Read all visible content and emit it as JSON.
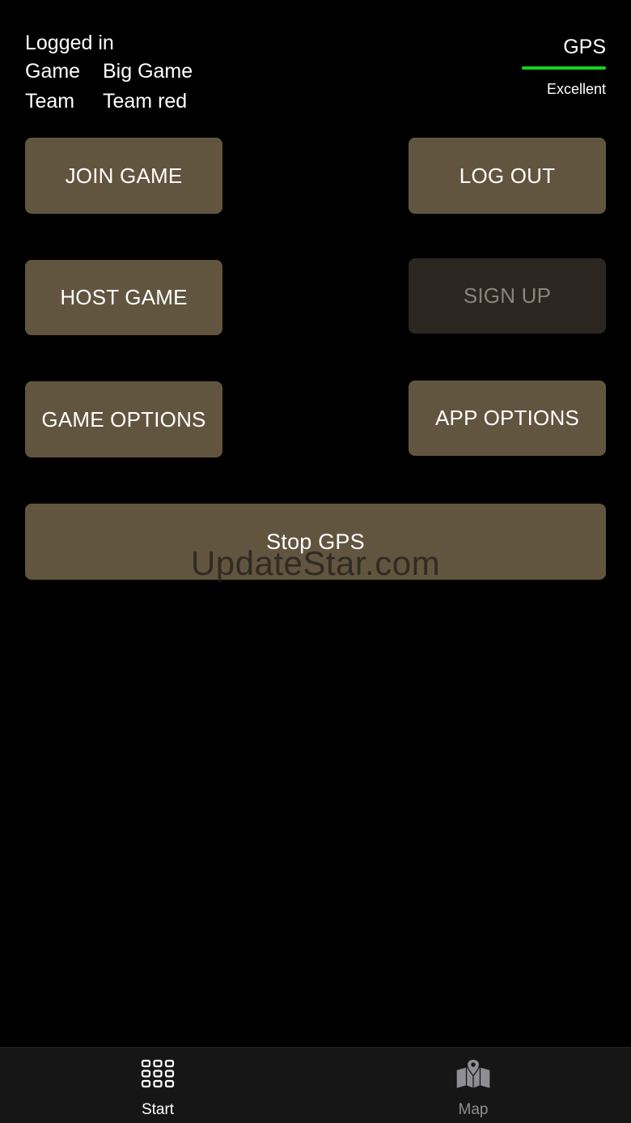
{
  "status": {
    "logged_in": "Logged in",
    "game_key": "Game",
    "game_value": "Big Game",
    "team_key": "Team",
    "team_value": "Team red"
  },
  "gps": {
    "label": "GPS",
    "quality": "Excellent",
    "signal_fraction": 1.0,
    "signal_color": "#19d219"
  },
  "buttons": {
    "join_game": "JOIN GAME",
    "log_out": "LOG OUT",
    "host_game": "HOST GAME",
    "sign_up": "SIGN UP",
    "game_options": "GAME OPTIONS",
    "app_options": "APP OPTIONS",
    "stop_gps": "Stop GPS"
  },
  "watermark": "UpdateStar.com",
  "tabbar": {
    "items": [
      {
        "label": "Start",
        "icon": "grid-icon",
        "active": true
      },
      {
        "label": "Map",
        "icon": "map-icon",
        "active": false
      }
    ]
  },
  "colors": {
    "background": "#000000",
    "button": "#62553f",
    "button_disabled": "#2b2620",
    "gps_ok": "#19d219"
  }
}
